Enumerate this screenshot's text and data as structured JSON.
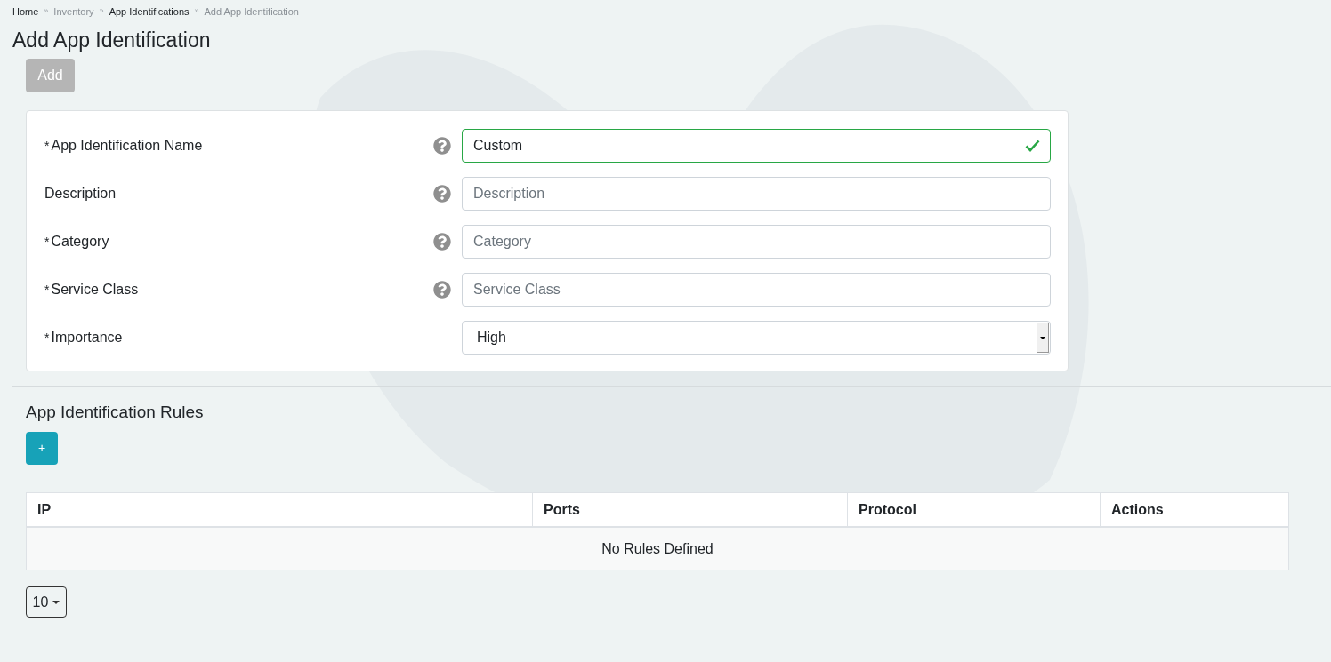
{
  "breadcrumb": [
    {
      "label": "Home",
      "kind": "link"
    },
    {
      "separator": "»",
      "label": "Inventory",
      "kind": "text"
    },
    {
      "separator": "»",
      "label": "App Identifications",
      "kind": "link"
    },
    {
      "separator": "»",
      "label": "Add App Identification",
      "kind": "text"
    }
  ],
  "title": "Add App Identification",
  "add_button": {
    "label": "Add",
    "disabled": true
  },
  "form": {
    "fields": [
      {
        "kind": "input",
        "mark": "*",
        "label": "App Identification Name",
        "help": true,
        "value": "Custom",
        "valid": true
      },
      {
        "kind": "input",
        "label": "Description",
        "help": true,
        "placeholder": "Description",
        "valid": false
      },
      {
        "kind": "input",
        "mark": "*",
        "label": "Category",
        "help": true,
        "placeholder": "Category",
        "valid": false
      },
      {
        "kind": "input",
        "mark": "*",
        "label": "Service Class",
        "help": true,
        "placeholder": "Service Class",
        "valid": false
      },
      {
        "kind": "select",
        "mark": "*",
        "label": "Importance",
        "help": false,
        "value": "High"
      }
    ]
  },
  "rules": {
    "title": "App Identification Rules",
    "add_label": "+",
    "table": {
      "columns": [
        "IP",
        "Ports",
        "Protocol",
        "Actions"
      ],
      "empty_text": "No Rules Defined"
    },
    "page_size": "10"
  }
}
